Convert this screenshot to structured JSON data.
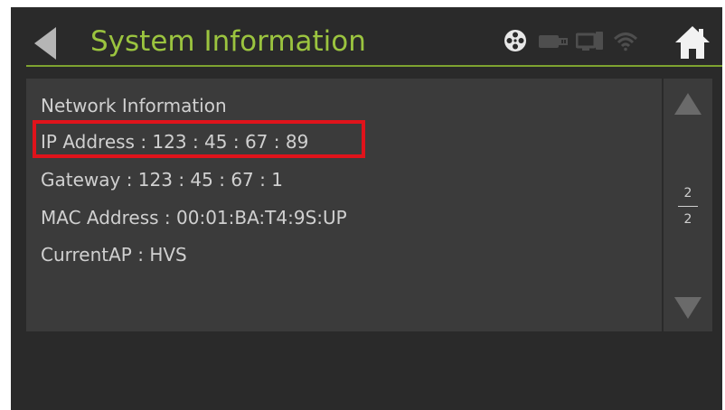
{
  "header": {
    "title": "System Information",
    "accent_color": "#9bc43f",
    "back_icon": "back-arrow-icon",
    "home_icon": "home-icon",
    "status_icons": [
      "film-reel-icon",
      "usb-device-icon",
      "display-link-icon",
      "wifi-icon"
    ]
  },
  "network": {
    "section_title": "Network Information",
    "ip_address": "IP Address : 123 : 45 : 67 : 89",
    "gateway": "Gateway : 123 : 45 : 67 : 1",
    "mac_address": "MAC Address : 00:01:BA:T4:9S:UP",
    "current_ap": "CurrentAP : HVS"
  },
  "highlight_color": "#e0131b",
  "pagination": {
    "current": "2",
    "total": "2"
  }
}
